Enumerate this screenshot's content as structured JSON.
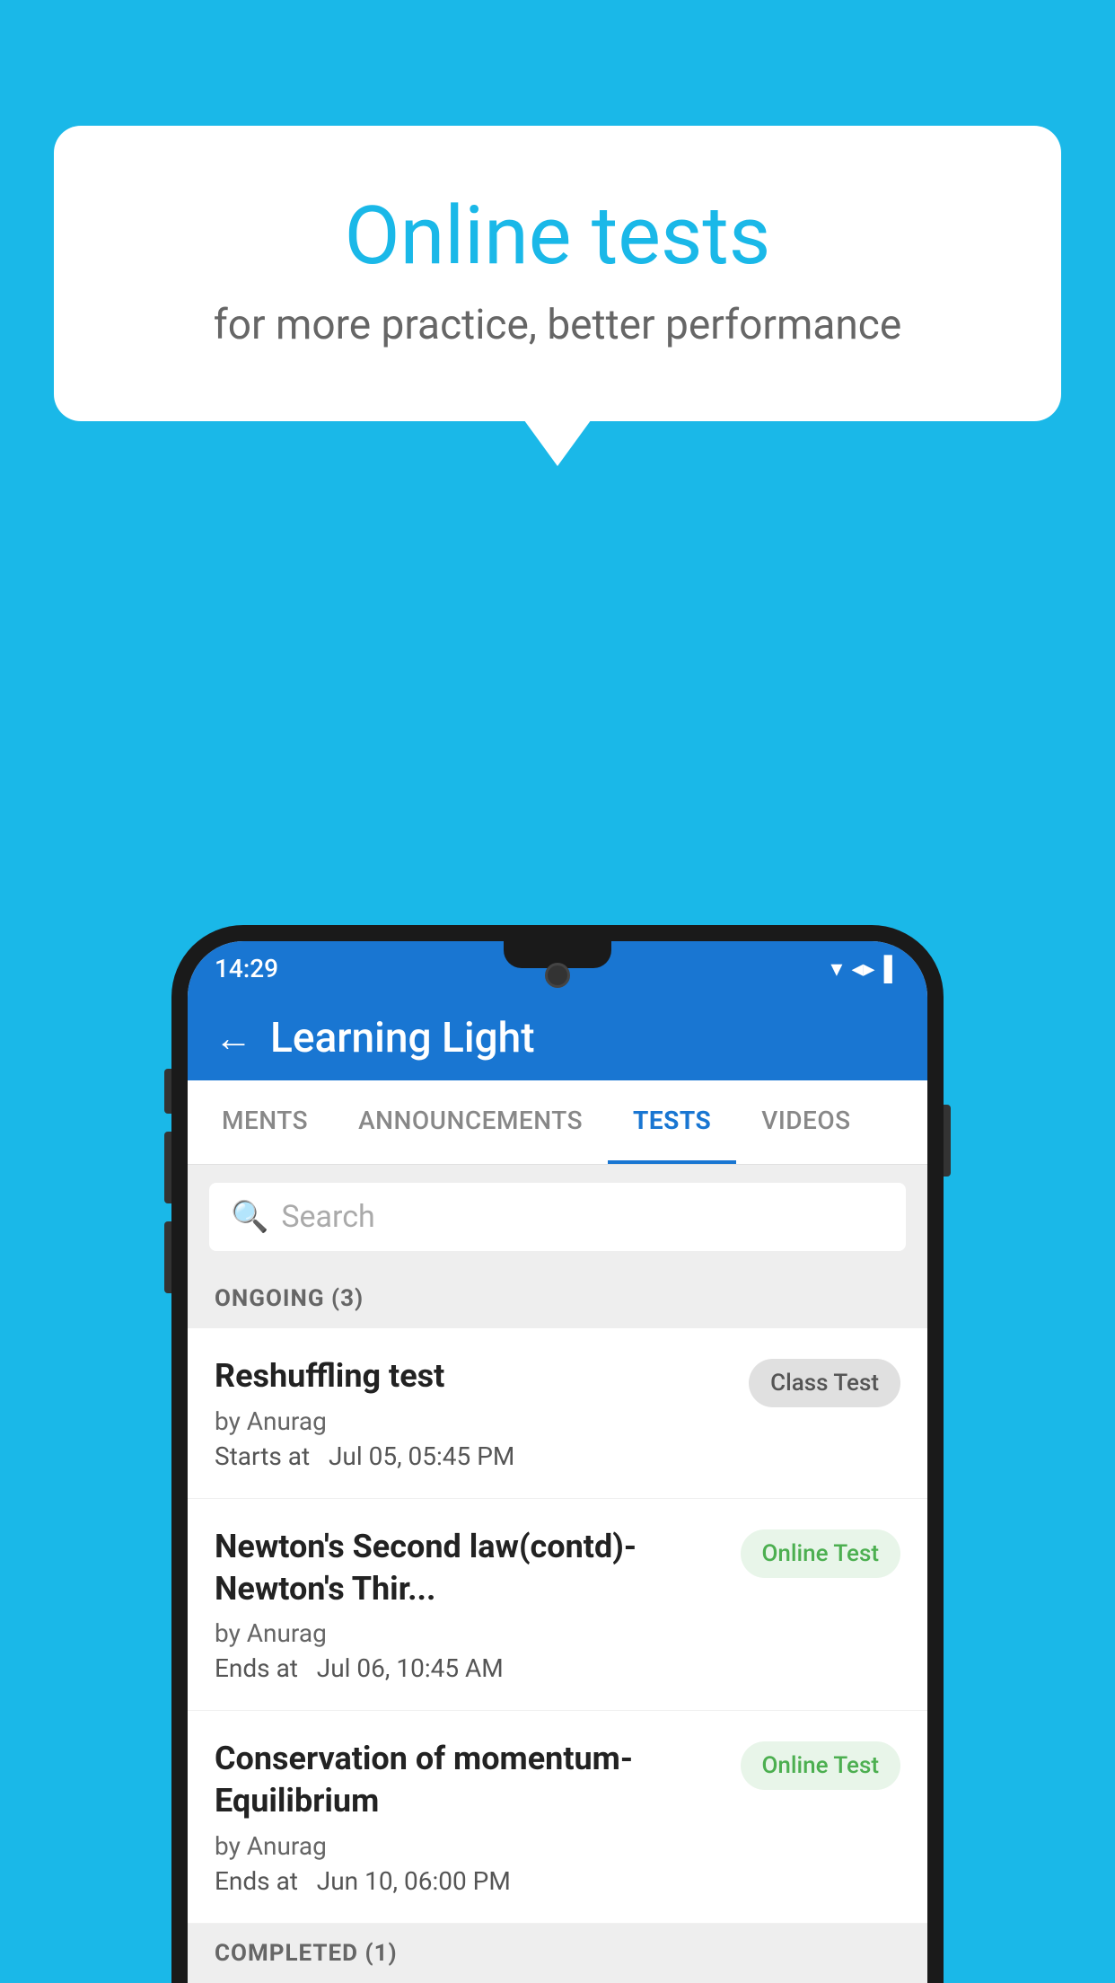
{
  "background_color": "#1ab8e8",
  "bubble": {
    "title": "Online tests",
    "subtitle": "for more practice, better performance"
  },
  "phone": {
    "status_bar": {
      "time": "14:29",
      "icons": [
        "wifi",
        "signal",
        "battery"
      ]
    },
    "app_bar": {
      "title": "Learning Light",
      "back_label": "←"
    },
    "tabs": [
      {
        "label": "MENTS",
        "active": false
      },
      {
        "label": "ANNOUNCEMENTS",
        "active": false
      },
      {
        "label": "TESTS",
        "active": true
      },
      {
        "label": "VIDEOS",
        "active": false
      }
    ],
    "search": {
      "placeholder": "Search"
    },
    "ongoing_section": {
      "label": "ONGOING (3)"
    },
    "tests": [
      {
        "name": "Reshuffling test",
        "author": "by Anurag",
        "date_label": "Starts at",
        "date": "Jul 05, 05:45 PM",
        "badge": "Class Test",
        "badge_type": "class"
      },
      {
        "name": "Newton's Second law(contd)-Newton's Thir...",
        "author": "by Anurag",
        "date_label": "Ends at",
        "date": "Jul 06, 10:45 AM",
        "badge": "Online Test",
        "badge_type": "online"
      },
      {
        "name": "Conservation of momentum-Equilibrium",
        "author": "by Anurag",
        "date_label": "Ends at",
        "date": "Jun 10, 06:00 PM",
        "badge": "Online Test",
        "badge_type": "online"
      }
    ],
    "completed_section": {
      "label": "COMPLETED (1)"
    }
  }
}
